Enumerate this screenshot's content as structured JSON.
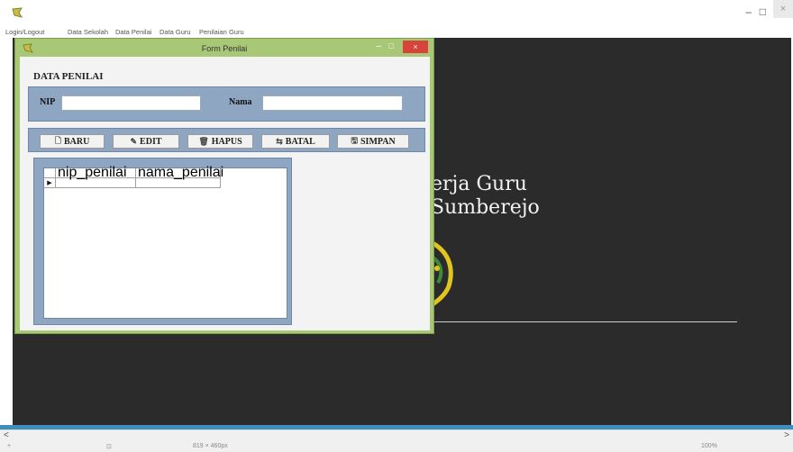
{
  "window": {
    "app_icon": "app-logo-icon",
    "minimize": "–",
    "maximize": "□",
    "close": "×"
  },
  "menu": {
    "items": [
      "Login/Logout",
      "Data Sekolah",
      "Data Penilai",
      "Data Guru",
      "Penilaian Guru"
    ]
  },
  "background": {
    "title_line1": "erja Guru",
    "title_line2": "Sumberejo"
  },
  "form": {
    "title": "Form Penilai",
    "minimize": "–",
    "maximize": "□",
    "close": "×",
    "section_title": "DATA PENILAI",
    "nip_label": "NIP",
    "nip_value": "",
    "nama_label": "Nama",
    "nama_value": "",
    "buttons": {
      "baru": "BARU",
      "edit": "EDIT",
      "hapus": "HAPUS",
      "batal": "BATAL",
      "simpan": "SIMPAN"
    },
    "grid": {
      "columns": [
        "nip_penilai",
        "nama_penilai"
      ],
      "row_indicator": "▶"
    }
  },
  "scrollbar": {
    "left": "<",
    "right": ">"
  },
  "status": {
    "left": "+",
    "mid1": "⊡",
    "dims": "819 × 460px",
    "zoom": "100%"
  }
}
